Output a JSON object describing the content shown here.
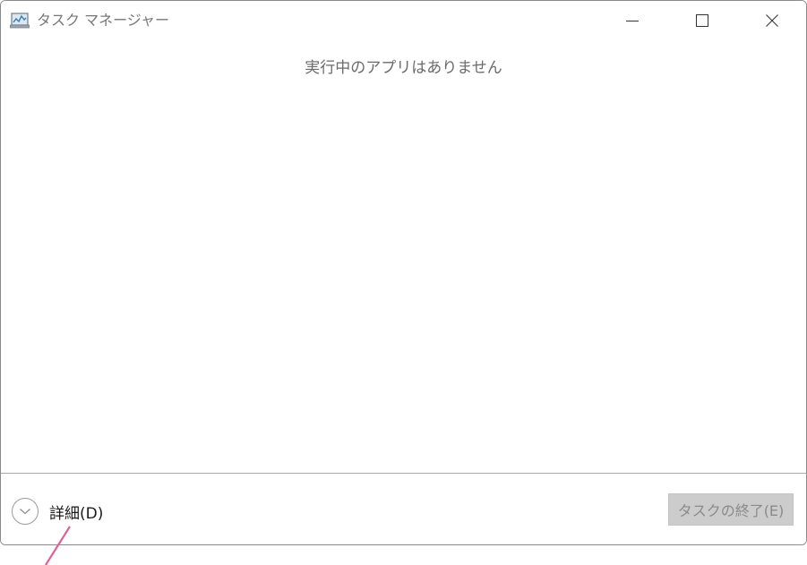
{
  "window": {
    "title": "タスク マネージャー"
  },
  "main": {
    "empty_message": "実行中のアプリはありません"
  },
  "footer": {
    "details_label": "詳細(D)",
    "end_task_label": "タスクの終了(E)"
  },
  "icons": {
    "app": "task-manager-icon",
    "minimize": "minimize-icon",
    "maximize": "maximize-icon",
    "close": "close-icon",
    "details": "chevron-down-icon"
  },
  "colors": {
    "annotation_line": "#e0609a",
    "disabled_button_bg": "#cccccc",
    "disabled_button_text": "#8a8a8a"
  }
}
